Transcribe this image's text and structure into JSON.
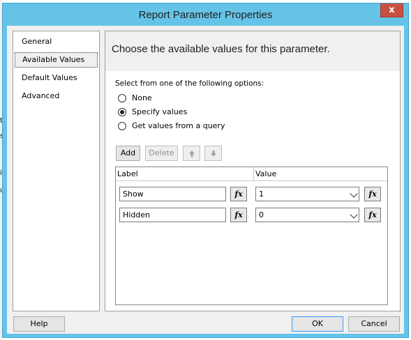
{
  "window": {
    "title": "Report Parameter Properties",
    "close_label": "x"
  },
  "background_fragments": [
    "t",
    "s",
    "i",
    "u"
  ],
  "nav": {
    "items": [
      "General",
      "Available Values",
      "Default Values",
      "Advanced"
    ]
  },
  "panel": {
    "heading": "Choose the available values for this parameter.",
    "section_label": "Select from one of the following options:",
    "options": [
      "None",
      "Specify values",
      "Get values from a query"
    ],
    "selected_option": "Specify values"
  },
  "toolbar": {
    "add": "Add",
    "delete": "Delete",
    "move_up": "up-arrow-icon",
    "move_down": "down-arrow-icon"
  },
  "grid": {
    "columns": [
      "Label",
      "Value"
    ],
    "rows": [
      {
        "label": "Show",
        "value": "1"
      },
      {
        "label": "Hidden",
        "value": "0"
      }
    ],
    "expression_glyph": "fx"
  },
  "footer": {
    "help": "Help",
    "ok": "OK",
    "cancel": "Cancel"
  },
  "colors": {
    "title_bar": "#66c3e8",
    "close_button": "#c7503f",
    "dialog_bg": "#f0f0f0"
  }
}
